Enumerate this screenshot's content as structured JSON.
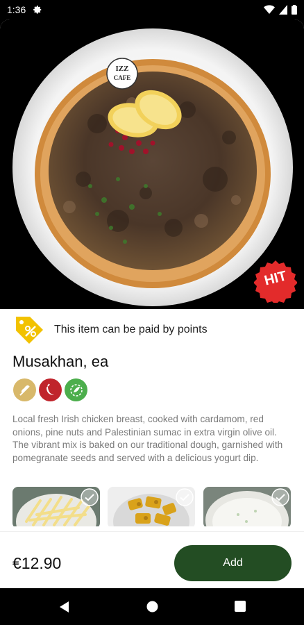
{
  "status_bar": {
    "time": "1:36",
    "icons": [
      "settings-icon",
      "wifi-icon",
      "signal-icon",
      "battery-icon"
    ]
  },
  "hero": {
    "image": "musakhan-flatbread-photo",
    "plate_logo_text": "IZZ CAFE",
    "badge_text": "HIT",
    "badge_color": "#e32b2b"
  },
  "points": {
    "icon": "discount-tag-icon",
    "text": "This item can be paid by points",
    "icon_color": "#f2c200"
  },
  "product": {
    "title": "Musakhan, ea",
    "diet_icons": [
      {
        "name": "wheat-icon",
        "color": "#d8b86a"
      },
      {
        "name": "chili-icon",
        "color": "#c0242c"
      },
      {
        "name": "vegan-leaf-icon",
        "color": "#4cae4c"
      }
    ],
    "description": "Local fresh Irish chicken breast, cooked with cardamom, red onions, pine nuts and Palestinian sumac in extra virgin olive oil. The vibrant mix is baked on our traditional dough, garnished with pomegranate seeds and served with a delicious yogurt dip."
  },
  "addons": [
    {
      "name": "fries-addon",
      "icon": "check-circle-icon"
    },
    {
      "name": "pickles-addon",
      "icon": "check-circle-icon"
    },
    {
      "name": "yogurt-dip-addon",
      "icon": "check-circle-icon"
    }
  ],
  "footer": {
    "price": "€12.90",
    "add_label": "Add",
    "accent": "#234d23"
  },
  "nav": {
    "icons": [
      "back-icon",
      "home-icon",
      "recents-icon"
    ]
  }
}
